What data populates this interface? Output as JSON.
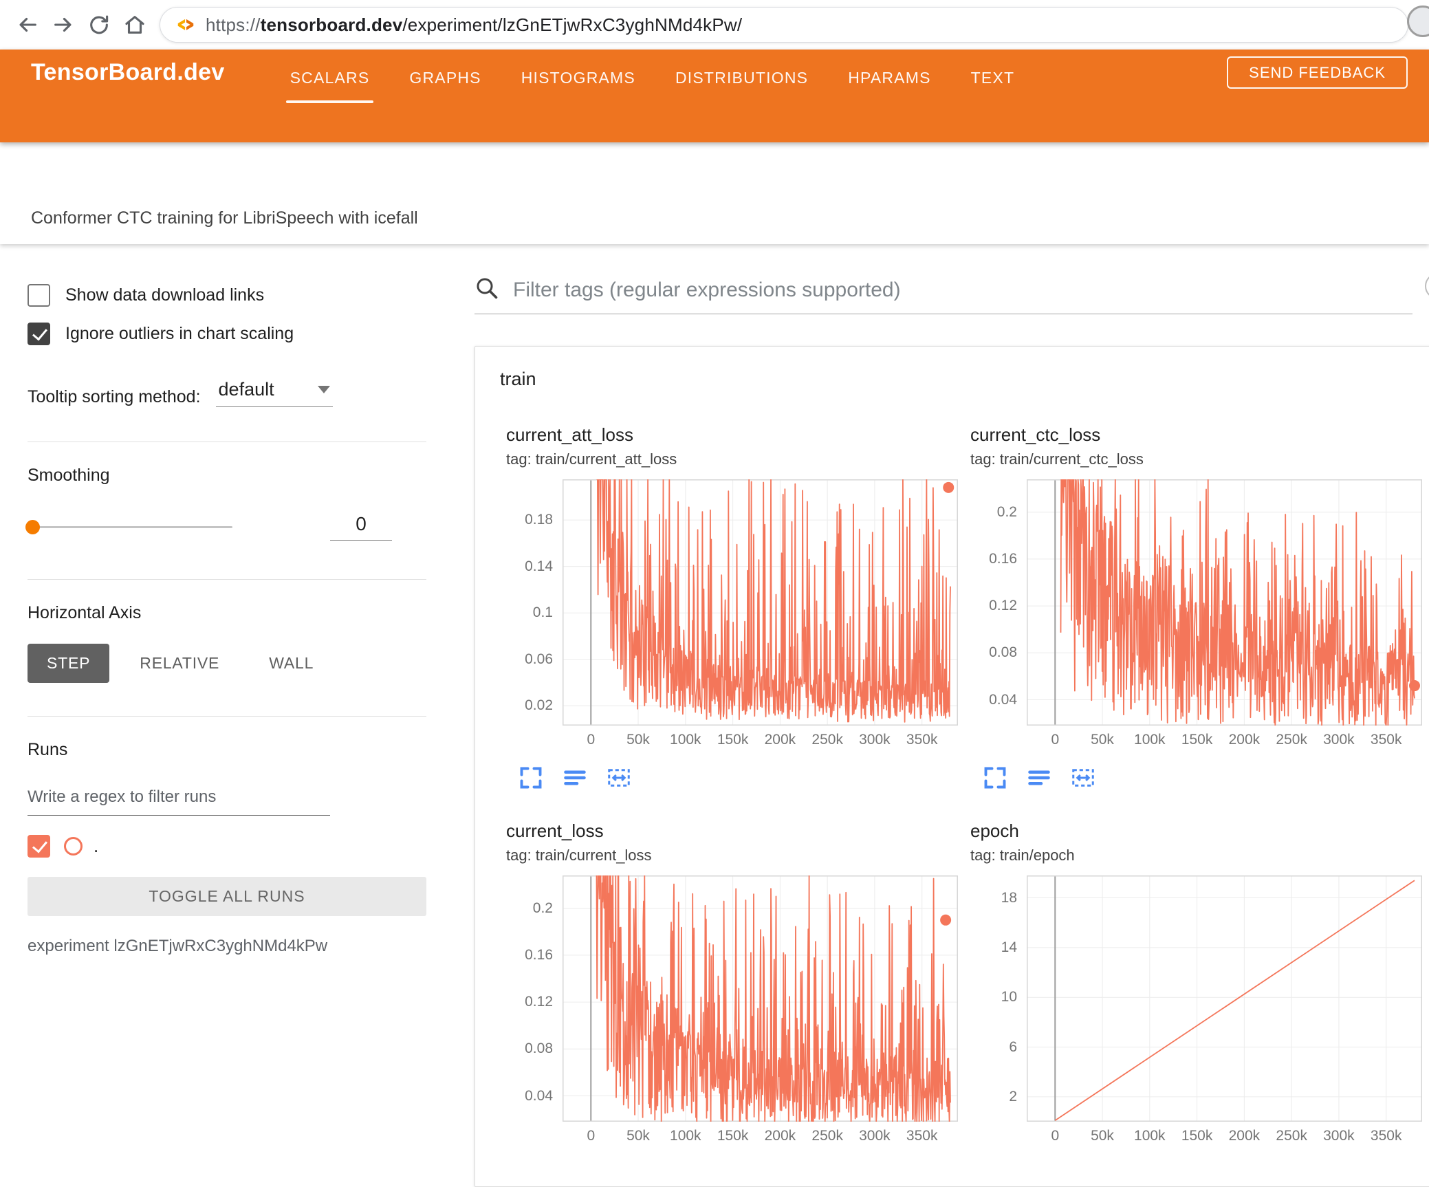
{
  "browser": {
    "url_scheme": "https://",
    "url_domain": "tensorboard.dev",
    "url_path": "/experiment/lzGnETjwRxC3yghNMd4kPw/"
  },
  "header": {
    "logo": "TensorBoard.dev",
    "tabs": [
      {
        "label": "SCALARS",
        "active": true
      },
      {
        "label": "GRAPHS",
        "active": false
      },
      {
        "label": "HISTOGRAMS",
        "active": false
      },
      {
        "label": "DISTRIBUTIONS",
        "active": false
      },
      {
        "label": "HPARAMS",
        "active": false
      },
      {
        "label": "TEXT",
        "active": false
      }
    ],
    "feedback_button": "SEND FEEDBACK"
  },
  "experiment": {
    "title": "Conformer CTC training for LibriSpeech with icefall"
  },
  "sidebar": {
    "show_data_download_links": {
      "label": "Show data download links",
      "checked": false
    },
    "ignore_outliers": {
      "label": "Ignore outliers in chart scaling",
      "checked": true
    },
    "tooltip_sorting": {
      "label": "Tooltip sorting method:",
      "value": "default"
    },
    "smoothing": {
      "label": "Smoothing",
      "value": "0"
    },
    "horizontal_axis": {
      "label": "Horizontal Axis",
      "options": [
        "STEP",
        "RELATIVE",
        "WALL"
      ],
      "selected": "STEP"
    },
    "runs": {
      "label": "Runs",
      "filter_placeholder": "Write a regex to filter runs",
      "run_name": ".",
      "run_checked": true,
      "toggle_button": "TOGGLE ALL RUNS",
      "experiment_label": "experiment lzGnETjwRxC3yghNMd4kPw"
    }
  },
  "main": {
    "filter_placeholder": "Filter tags (regular expressions supported)",
    "section": "train"
  },
  "colors": {
    "header_orange": "#ee7420",
    "accent_orange": "#f57c00",
    "run_orange": "#f4765a",
    "icon_blue": "#4a8af4",
    "axis_selected_bg": "#616161"
  },
  "chart_data": [
    {
      "name": "current_att_loss",
      "tag": "tag: train/current_att_loss",
      "type": "line",
      "x_range": [
        -30000,
        388000
      ],
      "x_tick_values": [
        0,
        50000,
        100000,
        150000,
        200000,
        250000,
        300000,
        350000
      ],
      "x_tick_labels": [
        "0",
        "50k",
        "100k",
        "150k",
        "200k",
        "250k",
        "300k",
        "350k"
      ],
      "y_range": [
        0.003,
        0.215
      ],
      "y_tick_values": [
        0.02,
        0.06,
        0.1,
        0.14,
        0.18
      ],
      "y_tick_labels": [
        "0.02",
        "0.06",
        "0.1",
        "0.14",
        "0.18"
      ],
      "trend": [
        [
          8000,
          0.3
        ],
        [
          20000,
          0.15
        ],
        [
          40000,
          0.075
        ],
        [
          80000,
          0.046
        ],
        [
          120000,
          0.034
        ],
        [
          200000,
          0.026
        ],
        [
          380000,
          0.022
        ]
      ],
      "noise": {
        "seed": 11,
        "points": 760,
        "x_start": 6000,
        "x_end": 380000,
        "band": [
          0.25,
          1.5
        ],
        "spike": 0.2,
        "spike_pow": 7
      },
      "end_dot": [
        378000,
        0.208
      ],
      "toolbar": true
    },
    {
      "name": "current_ctc_loss",
      "tag": "tag: train/current_ctc_loss",
      "type": "line",
      "x_range": [
        -30000,
        388000
      ],
      "x_tick_values": [
        0,
        50000,
        100000,
        150000,
        200000,
        250000,
        300000,
        350000
      ],
      "x_tick_labels": [
        "0",
        "50k",
        "100k",
        "150k",
        "200k",
        "250k",
        "300k",
        "350k"
      ],
      "y_range": [
        0.018,
        0.228
      ],
      "y_tick_values": [
        0.04,
        0.08,
        0.12,
        0.16,
        0.2
      ],
      "y_tick_labels": [
        "0.04",
        "0.08",
        "0.12",
        "0.16",
        "0.2"
      ],
      "trend": [
        [
          8000,
          0.24
        ],
        [
          20000,
          0.18
        ],
        [
          50000,
          0.12
        ],
        [
          100000,
          0.085
        ],
        [
          180000,
          0.065
        ],
        [
          280000,
          0.056
        ],
        [
          380000,
          0.05
        ]
      ],
      "noise": {
        "seed": 23,
        "points": 760,
        "x_start": 6000,
        "x_end": 380000,
        "band": [
          0.25,
          1.5
        ],
        "spike": 0.13,
        "spike_pow": 6
      },
      "end_dot": [
        380000,
        0.052
      ],
      "toolbar": true
    },
    {
      "name": "current_loss",
      "tag": "tag: train/current_loss",
      "type": "line",
      "x_range": [
        -30000,
        388000
      ],
      "x_tick_values": [
        0,
        50000,
        100000,
        150000,
        200000,
        250000,
        300000,
        350000
      ],
      "x_tick_labels": [
        "0",
        "50k",
        "100k",
        "150k",
        "200k",
        "250k",
        "300k",
        "350k"
      ],
      "y_range": [
        0.018,
        0.228
      ],
      "y_tick_values": [
        0.04,
        0.08,
        0.12,
        0.16,
        0.2
      ],
      "y_tick_labels": [
        "0.04",
        "0.08",
        "0.12",
        "0.16",
        "0.2"
      ],
      "trend": [
        [
          8000,
          0.33
        ],
        [
          20000,
          0.17
        ],
        [
          40000,
          0.095
        ],
        [
          80000,
          0.062
        ],
        [
          120000,
          0.05
        ],
        [
          200000,
          0.042
        ],
        [
          380000,
          0.038
        ]
      ],
      "noise": {
        "seed": 37,
        "points": 760,
        "x_start": 6000,
        "x_end": 380000,
        "band": [
          0.25,
          1.5
        ],
        "spike": 0.18,
        "spike_pow": 7
      },
      "end_dot": [
        375000,
        0.19
      ],
      "toolbar": false
    },
    {
      "name": "epoch",
      "tag": "tag: train/epoch",
      "type": "line",
      "x_range": [
        -30000,
        388000
      ],
      "x_tick_values": [
        0,
        50000,
        100000,
        150000,
        200000,
        250000,
        300000,
        350000
      ],
      "x_tick_labels": [
        "0",
        "50k",
        "100k",
        "150k",
        "200k",
        "250k",
        "300k",
        "350k"
      ],
      "y_range": [
        0,
        19.8
      ],
      "y_tick_values": [
        2,
        6,
        10,
        14,
        18
      ],
      "y_tick_labels": [
        "2",
        "6",
        "10",
        "14",
        "18"
      ],
      "points": [
        [
          0,
          0.1
        ],
        [
          380000,
          19.4
        ]
      ],
      "toolbar": false
    }
  ]
}
